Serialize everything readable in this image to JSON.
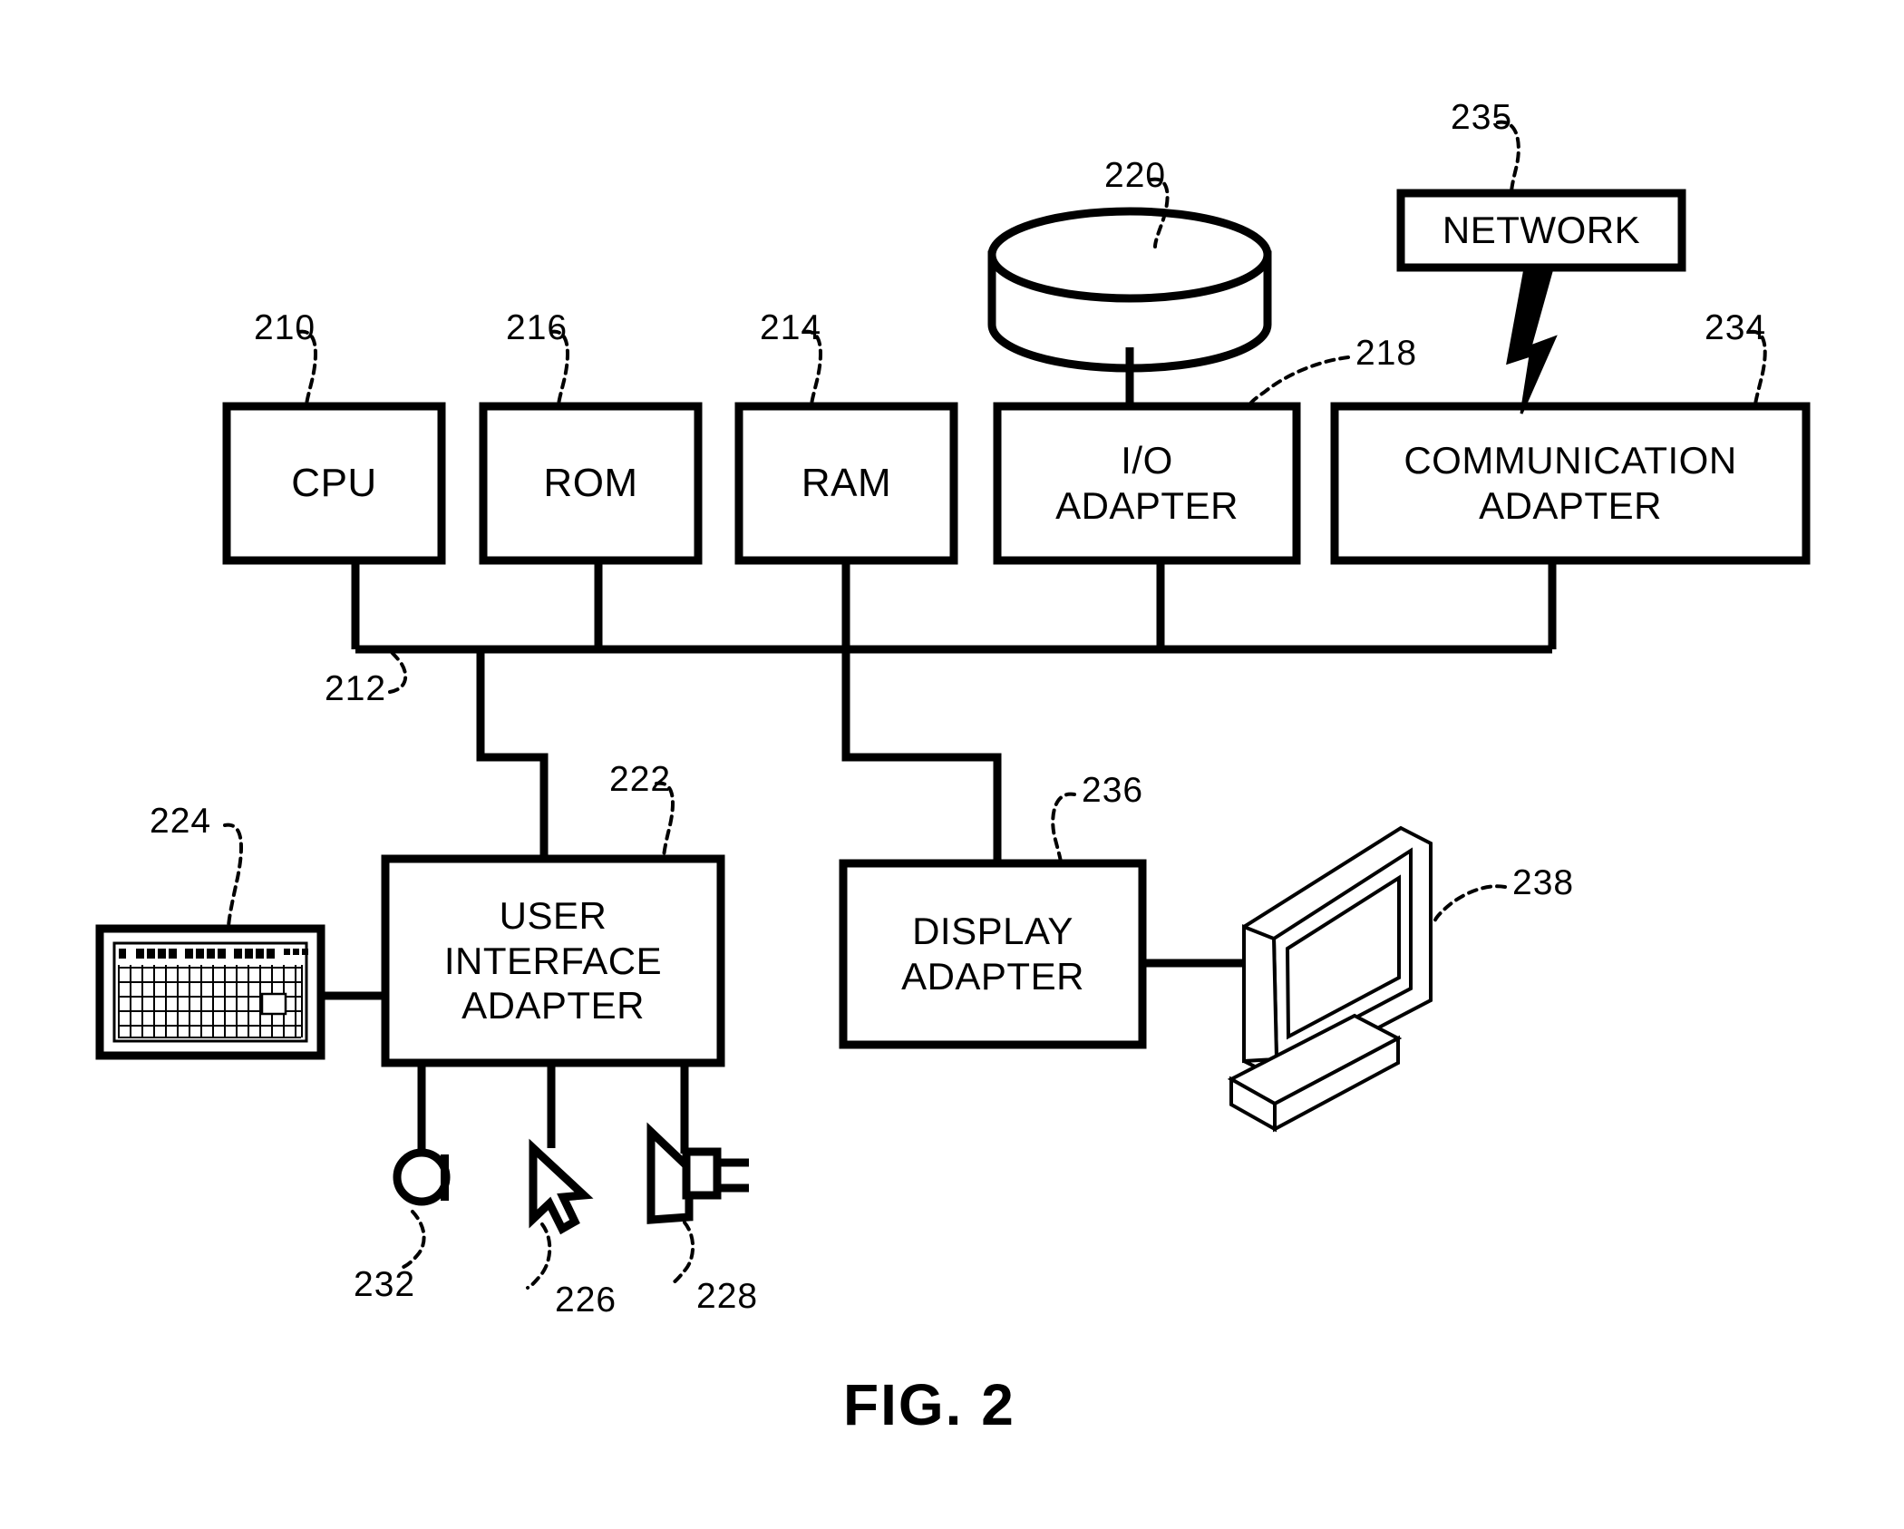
{
  "figure": {
    "caption": "FIG. 2",
    "type": "patent-block-diagram"
  },
  "blocks": {
    "cpu": {
      "label": "CPU",
      "ref": "210"
    },
    "rom": {
      "label": "ROM",
      "ref": "216"
    },
    "ram": {
      "label": "RAM",
      "ref": "214"
    },
    "io_adapter": {
      "line1": "I/O",
      "line2": "ADAPTER",
      "ref": "218"
    },
    "communication_adapter": {
      "line1": "COMMUNICATION",
      "line2": "ADAPTER",
      "ref": "234"
    },
    "network": {
      "label": "NETWORK",
      "ref": "235"
    },
    "user_interface_adapter": {
      "line1": "USER",
      "line2": "INTERFACE",
      "line3": "ADAPTER",
      "ref": "222"
    },
    "display_adapter": {
      "line1": "DISPLAY",
      "line2": "ADAPTER",
      "ref": "236"
    }
  },
  "devices": {
    "disk": {
      "ref": "220",
      "icon": "disk-drive-icon"
    },
    "keyboard": {
      "ref": "224",
      "icon": "keyboard-icon"
    },
    "microphone": {
      "ref": "232",
      "icon": "microphone-icon"
    },
    "mouse": {
      "ref": "226",
      "icon": "mouse-cursor-icon"
    },
    "speaker": {
      "ref": "228",
      "icon": "speaker-icon"
    },
    "monitor": {
      "ref": "238",
      "icon": "monitor-icon"
    }
  },
  "bus": {
    "ref": "212"
  },
  "colors": {
    "stroke": "#000000",
    "background": "#ffffff"
  }
}
